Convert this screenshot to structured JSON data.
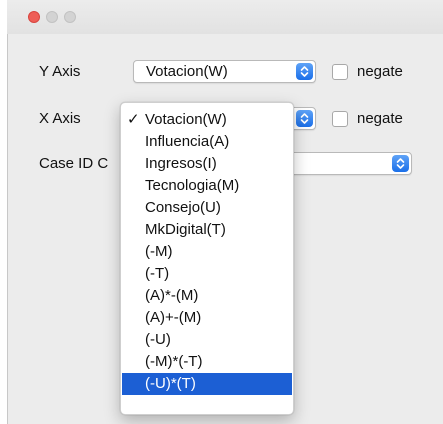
{
  "window": {
    "controls": {
      "close_color": "#ee5e57",
      "inactive_color": "#d3d3d3"
    }
  },
  "form": {
    "y_axis": {
      "label": "Y Axis",
      "selected": "Votacion(W)",
      "negate_label": "negate",
      "negate_checked": false
    },
    "x_axis": {
      "label": "X Axis",
      "negate_label": "negate",
      "negate_checked": false
    },
    "case_id": {
      "label_visible": "Case ID C"
    }
  },
  "dropdown_menu": {
    "checked_item": "Votacion(W)",
    "items": [
      "Votacion(W)",
      "Influencia(A)",
      "Ingresos(I)",
      "Tecnologia(M)",
      "Consejo(U)",
      "MkDigital(T)",
      "(-M)",
      "(-T)",
      "(A)*-(M)",
      "(A)+-(M)",
      "(-U)",
      "(-M)*(-T)",
      "(-U)*(T)"
    ],
    "highlighted_item": "(-U)*(T)",
    "highlight_color": "#1c5fd4"
  },
  "icons": {
    "check": "✓",
    "stepper": "chevron-up-down-icon"
  }
}
